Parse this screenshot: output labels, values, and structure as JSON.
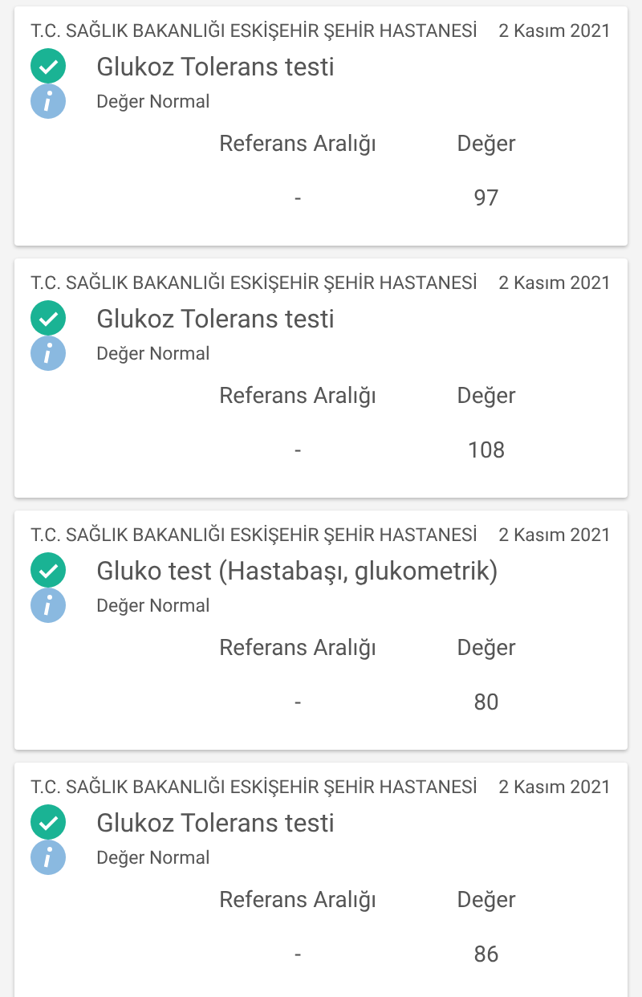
{
  "results": [
    {
      "hospital": "T.C. SAĞLIK BAKANLIĞI ESKİŞEHİR ŞEHİR HASTANESİ",
      "date": "2 Kasım 2021",
      "test": "Glukoz Tolerans testi",
      "status": "Değer Normal",
      "columns": [
        "Referans Aralığı",
        "Değer"
      ],
      "values": [
        "-",
        "97"
      ]
    },
    {
      "hospital": "T.C. SAĞLIK BAKANLIĞI ESKİŞEHİR ŞEHİR HASTANESİ",
      "date": "2 Kasım 2021",
      "test": "Glukoz Tolerans testi",
      "status": "Değer Normal",
      "columns": [
        "Referans Aralığı",
        "Değer"
      ],
      "values": [
        "-",
        "108"
      ]
    },
    {
      "hospital": "T.C. SAĞLIK BAKANLIĞI ESKİŞEHİR ŞEHİR HASTANESİ",
      "date": "2 Kasım 2021",
      "test": "Gluko test (Hastabaşı, glukometrik)",
      "status": "Değer Normal",
      "columns": [
        "Referans Aralığı",
        "Değer"
      ],
      "values": [
        "-",
        "80"
      ]
    },
    {
      "hospital": "T.C. SAĞLIK BAKANLIĞI ESKİŞEHİR ŞEHİR HASTANESİ",
      "date": "2 Kasım 2021",
      "test": "Glukoz Tolerans testi",
      "status": "Değer Normal",
      "columns": [
        "Referans Aralığı",
        "Değer"
      ],
      "values": [
        "-",
        "86"
      ]
    }
  ]
}
